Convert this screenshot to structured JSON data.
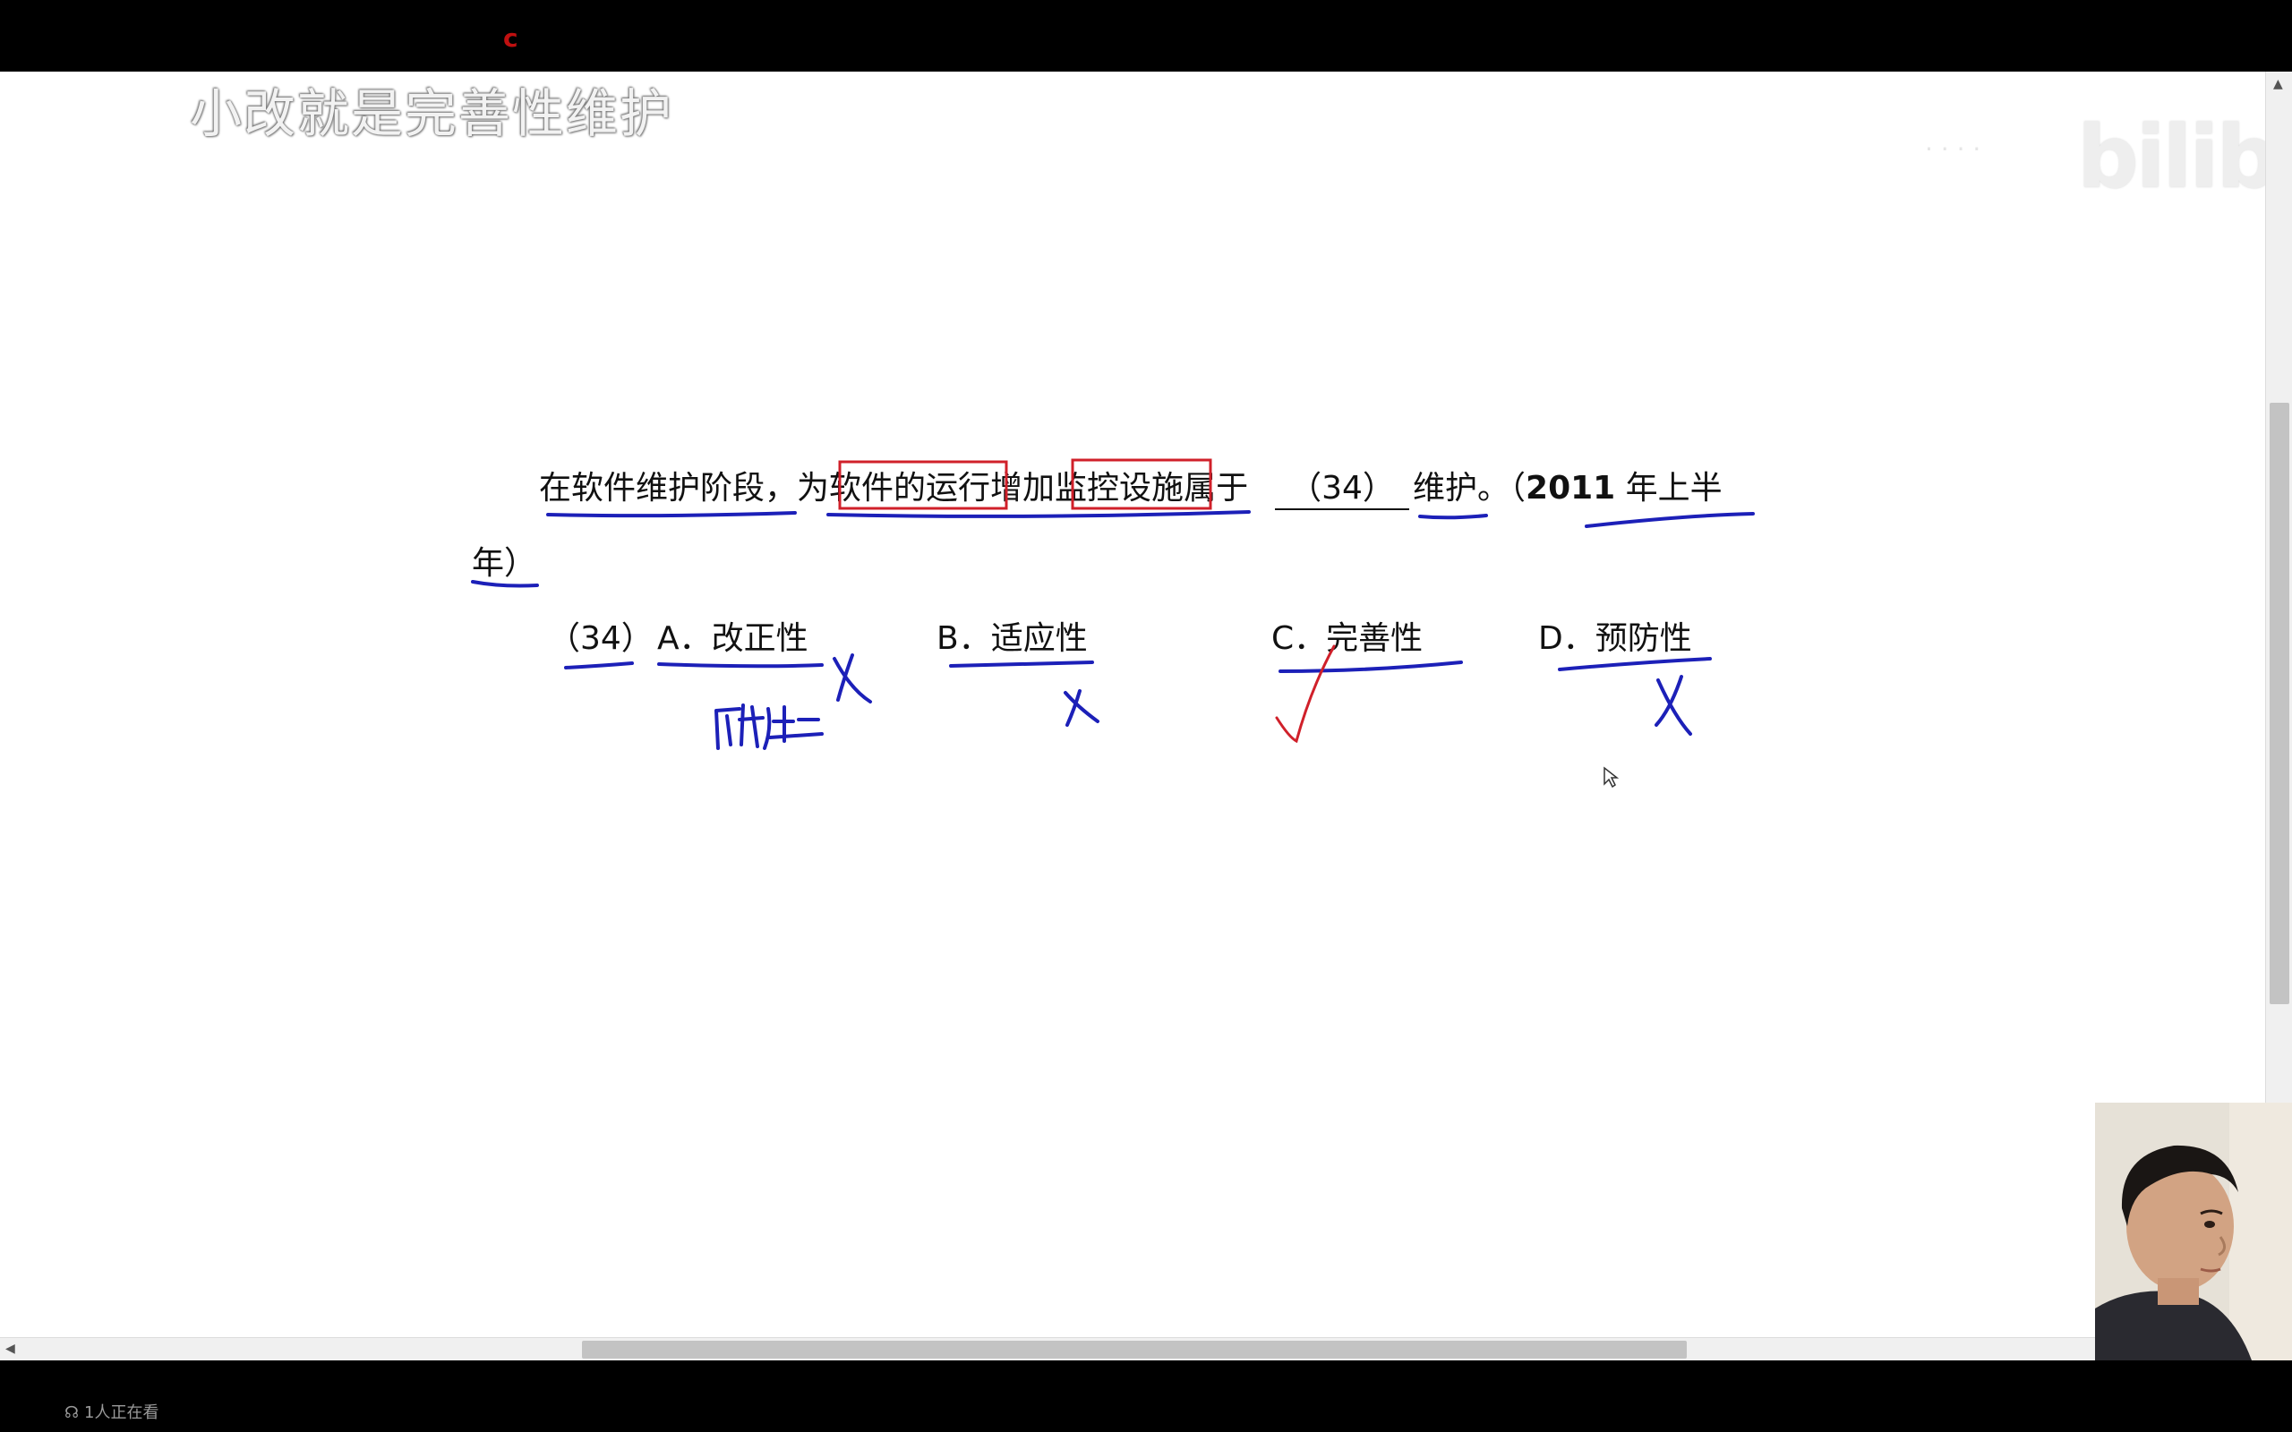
{
  "top_bar": {
    "logo_letter": "c"
  },
  "subtitle": "小改就是完善性维护",
  "watermark": {
    "brand": "bilibili"
  },
  "question": {
    "segments": {
      "s1": "在软件维护阶段，为",
      "s2": "软件的运行",
      "s3": "增加",
      "s4": "监控设施",
      "s5": "属于",
      "blank": "（34）",
      "s6": "维护。（",
      "year": "2011",
      "s7": " 年上半",
      "line2": "年）"
    },
    "number": "（34）",
    "options": [
      {
        "letter": "A．",
        "text": "改正性"
      },
      {
        "letter": "B．",
        "text": "适应性"
      },
      {
        "letter": "C．",
        "text": "完善性"
      },
      {
        "letter": "D．",
        "text": "预防性"
      }
    ]
  },
  "annotations": {
    "mark_wrong": "X",
    "handwritten_note": "改错性",
    "colors": {
      "pen_blue": "#1c20b8",
      "pen_red": "#d0202a"
    }
  },
  "status": {
    "viewers": "1人正在看"
  }
}
